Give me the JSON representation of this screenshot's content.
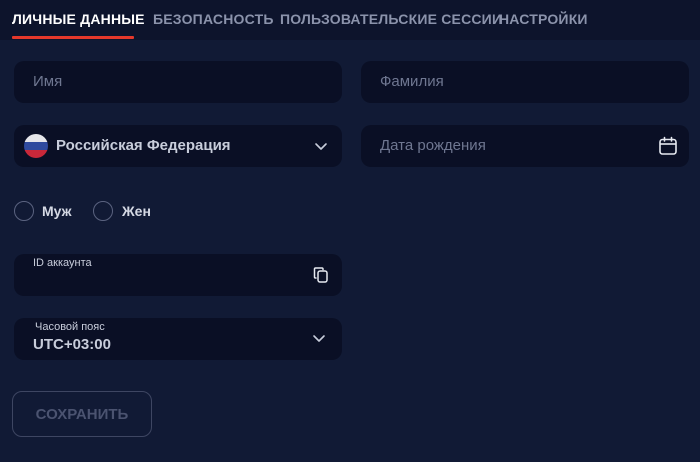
{
  "tabs": [
    {
      "label": "ЛИЧНЫЕ ДАННЫЕ",
      "active": true
    },
    {
      "label": "БЕЗОПАСНОСТЬ"
    },
    {
      "label": "ПОЛЬЗОВАТЕЛЬСКИЕ СЕССИИ"
    },
    {
      "label": "НАСТРОЙКИ"
    }
  ],
  "form": {
    "first_name_placeholder": "Имя",
    "last_name_placeholder": "Фамилия",
    "country": {
      "value": "Российская Федерация",
      "flag_icon": "russia-flag-icon"
    },
    "birth_date_placeholder": "Дата рождения",
    "gender": {
      "options": [
        "Муж",
        "Жен"
      ],
      "selected": null
    },
    "account_id": {
      "label": "ID аккаунта",
      "value": ""
    },
    "timezone": {
      "label": "Часовой пояс",
      "value": "UTC+03:00"
    },
    "save_label": "СОХРАНИТЬ"
  },
  "colors": {
    "background": "#111a35",
    "tab_bar": "#0d142c",
    "field": "#0a0f25",
    "accent": "#e5382b"
  }
}
